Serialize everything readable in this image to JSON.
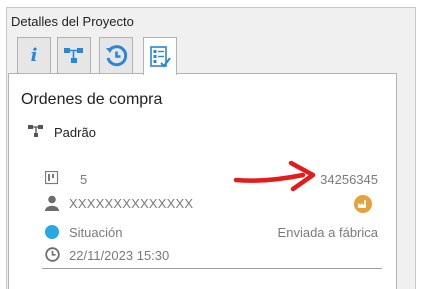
{
  "panel": {
    "title": "Detalles del Proyecto"
  },
  "tabs": [
    {
      "icon": "info-icon"
    },
    {
      "icon": "hierarchy-icon"
    },
    {
      "icon": "history-icon"
    },
    {
      "icon": "checklist-icon",
      "active": true
    }
  ],
  "content": {
    "heading": "Ordenes de compra",
    "hierarchy_label": "Padrão",
    "item_count": "5",
    "order_number": "34256345",
    "user": "XXXXXXXXXXXXXX",
    "status_label": "Situación",
    "status_value": "Enviada a fábrica",
    "status_color": "#27a9e1",
    "datetime": "22/11/2023 15:30"
  },
  "colors": {
    "accent": "#2b86d6",
    "annotation_arrow": "#e31b1b",
    "factory_badge": "#e8a13a"
  }
}
